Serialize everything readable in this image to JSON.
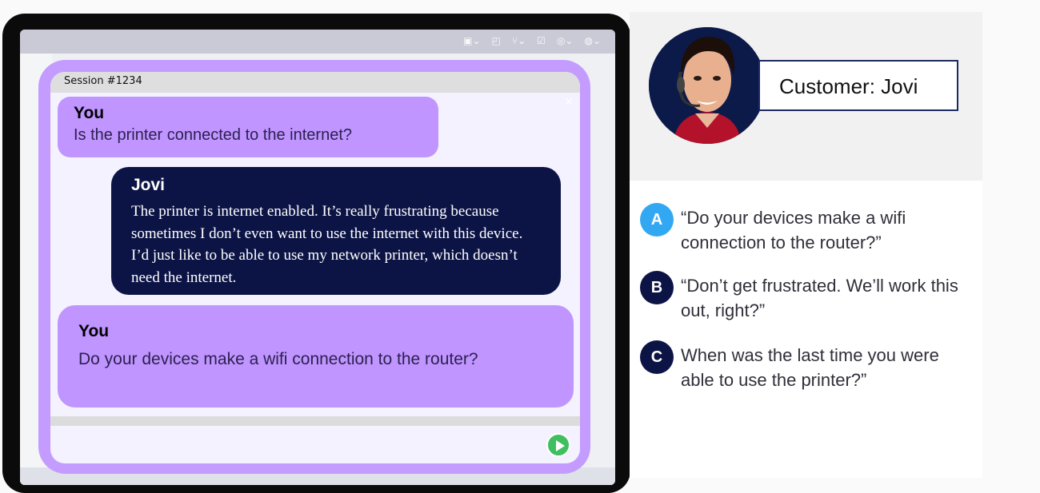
{
  "session": {
    "label": "Session #1234"
  },
  "messages": [
    {
      "sender": "You",
      "text": "Is the printer connected to the internet?"
    },
    {
      "sender": "Jovi",
      "text": "The printer is internet enabled. It’s really frustrating because sometimes I don’t even want to use the internet with this device. I’d just like to be able to use my network printer, which doesn’t need the internet."
    },
    {
      "sender": "You",
      "text": "Do your devices make a wifi connection to the router?"
    }
  ],
  "customer": {
    "label": "Customer: Jovi"
  },
  "options": [
    {
      "letter": "A",
      "text": "“Do your devices make a wifi connection to the router?”",
      "color": "#33a8f2"
    },
    {
      "letter": "B",
      "text": "“Don’t get frustrated. We’ll work this out, right?”",
      "color": "#0c1445"
    },
    {
      "letter": "C",
      "text": "When was the last time you were able to use the printer?”",
      "color": "#0c1445"
    }
  ],
  "colors": {
    "chat_frame": "#c49cff",
    "you_bubble": "#c095ff",
    "jovi_bubble": "#0c1445",
    "send_button": "#3fbf60"
  },
  "icons": [
    "send-icon",
    "close-icon",
    "headset-avatar"
  ]
}
